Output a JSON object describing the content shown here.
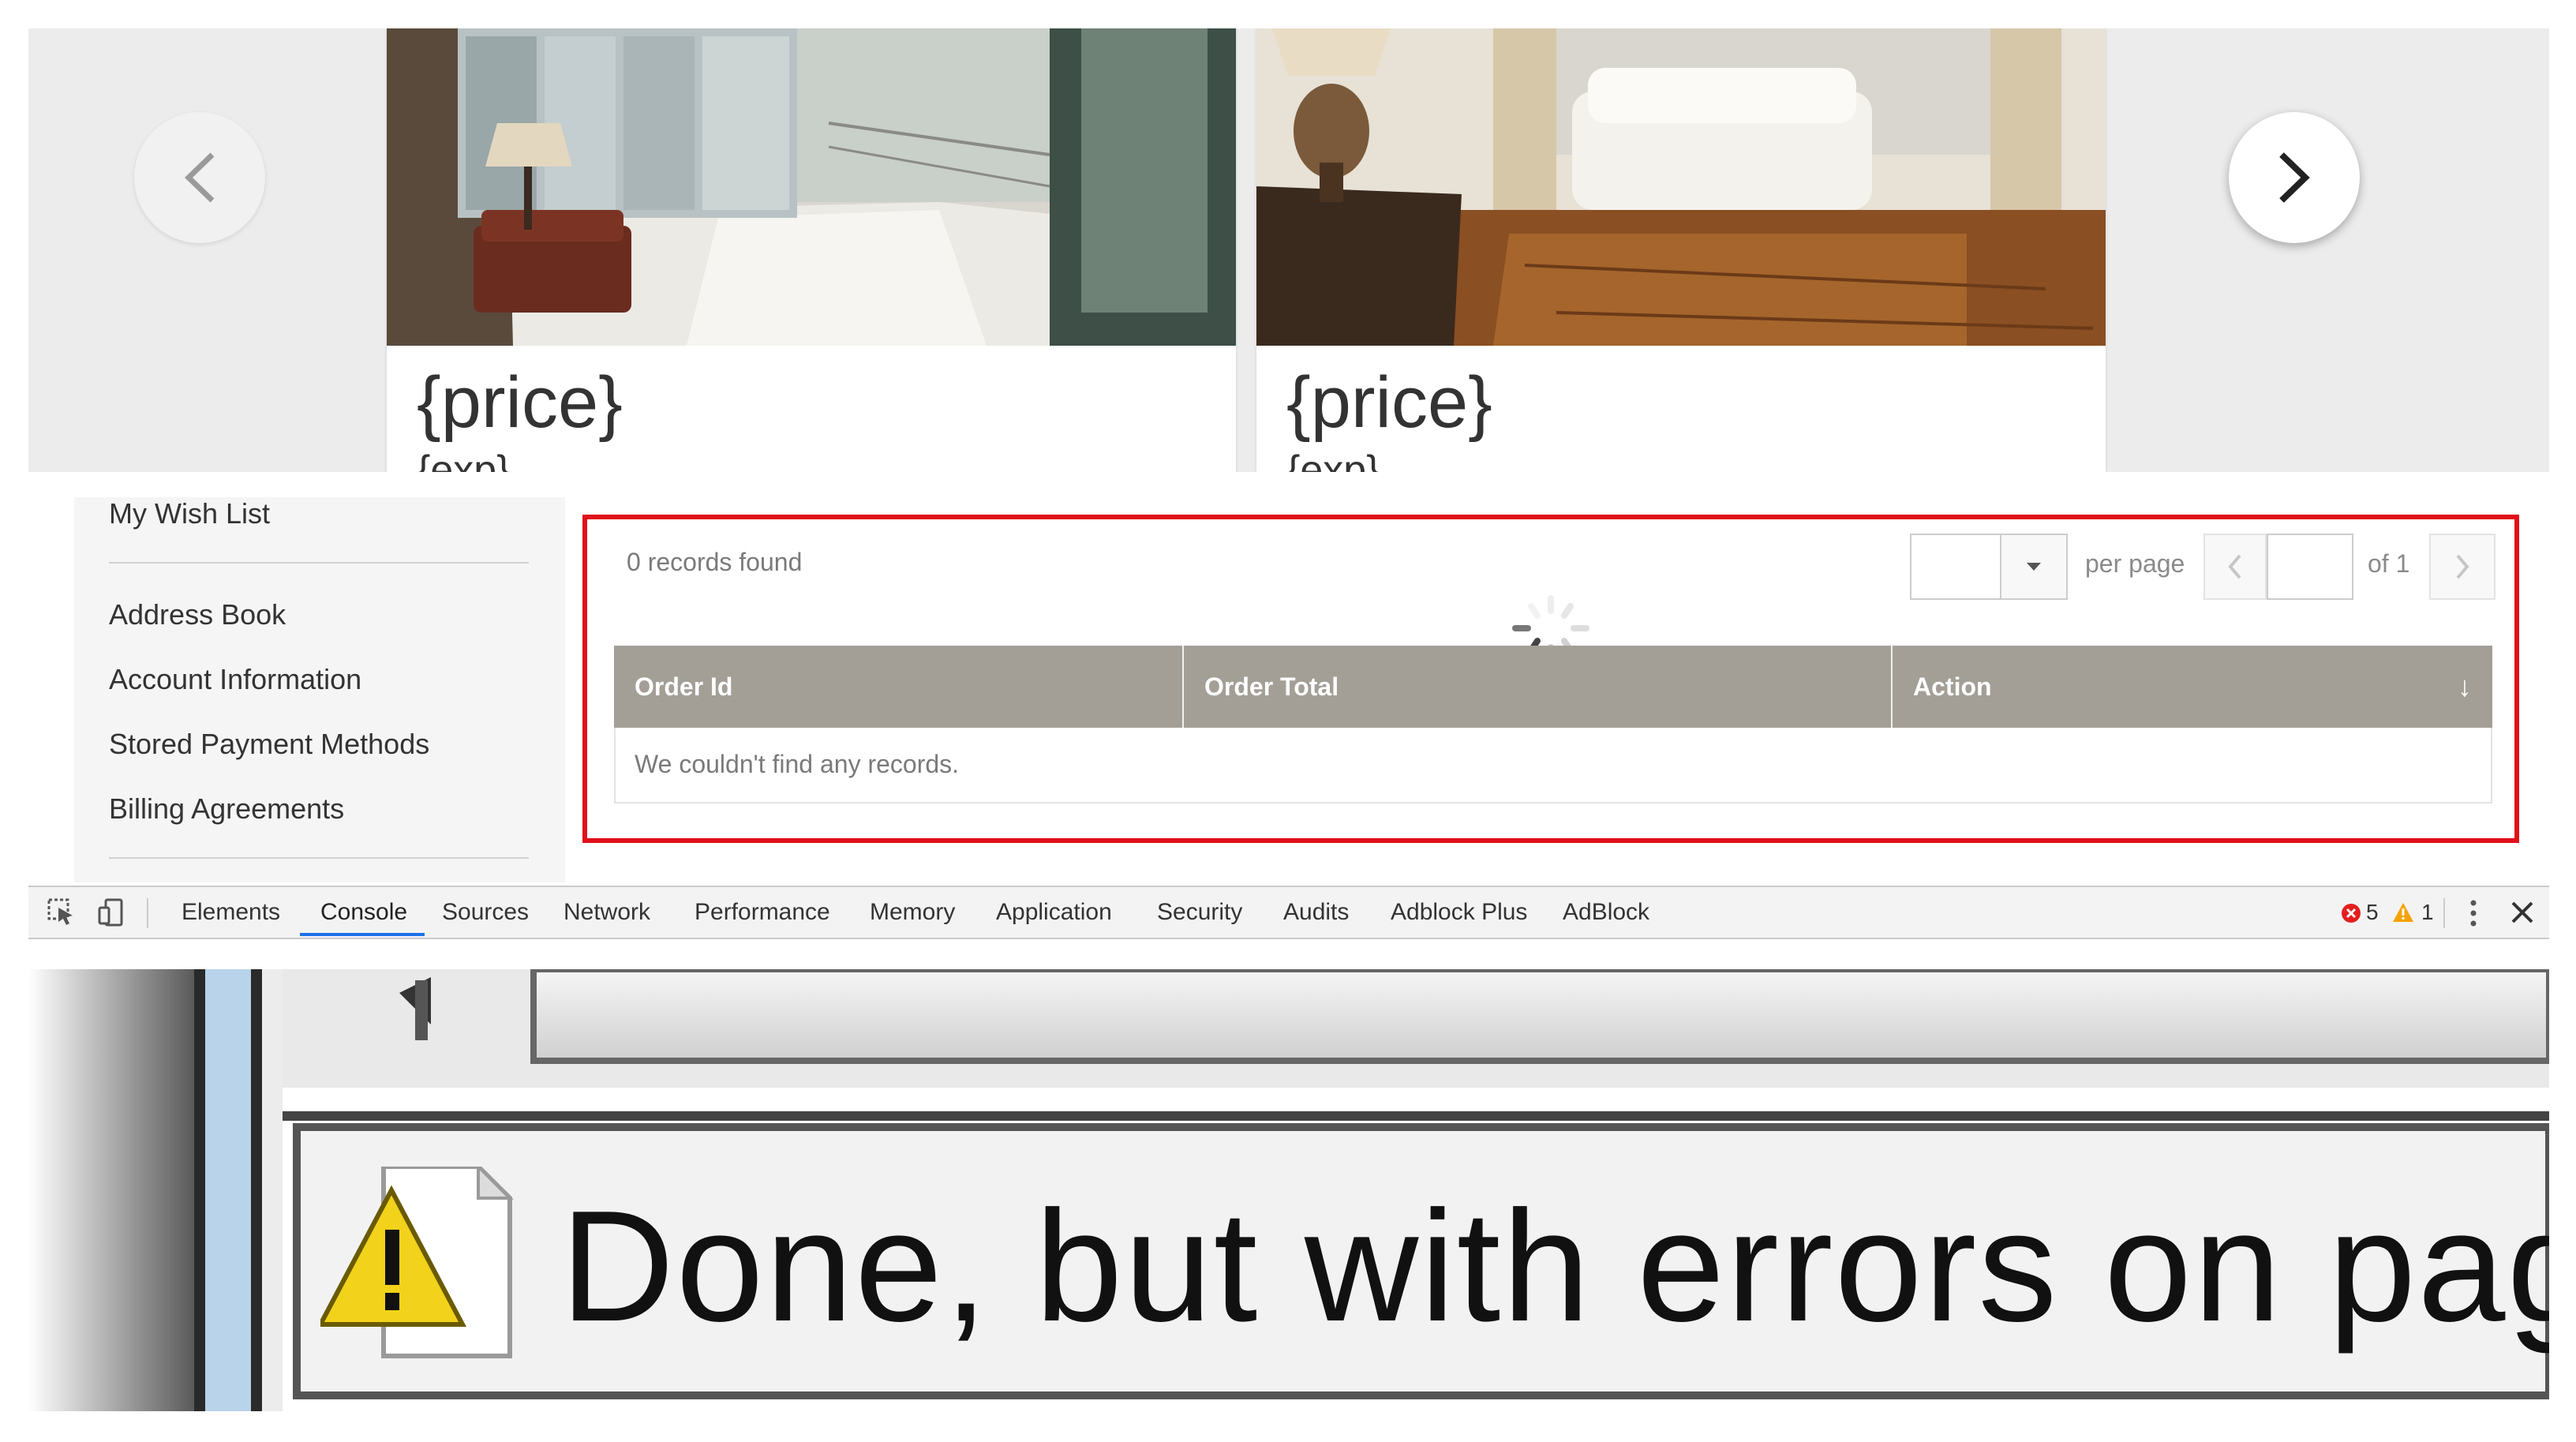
{
  "carousel": {
    "cards": [
      {
        "price": "{price}",
        "exp": "{exp}",
        "photo": "lobby-interior-photo"
      },
      {
        "price": "{price}",
        "exp": "{exp}",
        "photo": "living-room-interior-photo"
      }
    ],
    "prev_icon": "chevron-left-icon",
    "next_icon": "chevron-right-icon"
  },
  "sidebar": {
    "items": [
      {
        "label": "My Wish List"
      },
      {
        "label": "Address Book"
      },
      {
        "label": "Account Information"
      },
      {
        "label": "Stored Payment Methods"
      },
      {
        "label": "Billing Agreements"
      }
    ]
  },
  "grid": {
    "records_found": "0 records found",
    "per_page_label": "per page",
    "per_page_value": "",
    "page_value": "",
    "of_pages": "of 1",
    "columns": [
      "Order Id",
      "Order Total",
      "Action"
    ],
    "sort_indicator": "↓",
    "empty_message": "We couldn't find any records.",
    "highlight_color": "#e0101a",
    "header_color": "#a39f97"
  },
  "devtools": {
    "tabs": [
      "Elements",
      "Console",
      "Sources",
      "Network",
      "Performance",
      "Memory",
      "Application",
      "Security",
      "Audits",
      "Adblock Plus",
      "AdBlock"
    ],
    "active_tab": "Console",
    "error_count": "5",
    "warning_count": "1",
    "icons": [
      "inspect-icon",
      "device-toolbar-icon",
      "error-icon",
      "warning-icon",
      "more-vertical-icon",
      "close-icon"
    ]
  },
  "ie_status": {
    "message": "Done, but with errors on page.",
    "icon": "warning-page-icon"
  }
}
